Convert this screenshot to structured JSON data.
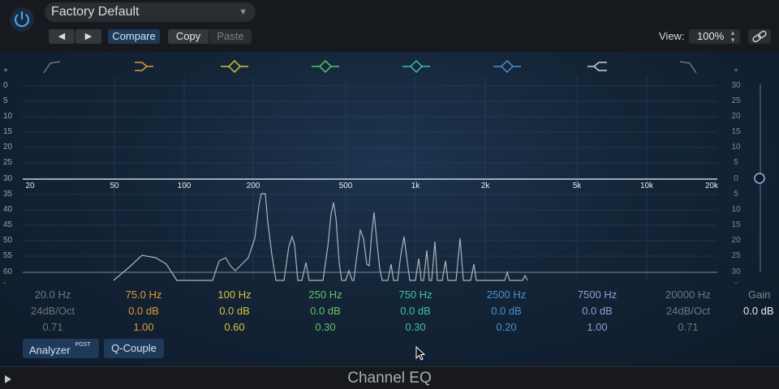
{
  "header": {
    "preset": "Factory Default",
    "compare_label": "Compare",
    "copy_label": "Copy",
    "paste_label": "Paste",
    "view_label": "View:",
    "view_value": "100%"
  },
  "eq": {
    "db_scale_left": [
      "+",
      "0",
      "5",
      "10",
      "15",
      "20",
      "25",
      "30",
      "35",
      "40",
      "45",
      "50",
      "55",
      "60",
      "-"
    ],
    "db_scale_right": [
      "+",
      "30",
      "25",
      "20",
      "15",
      "10",
      "5",
      "0",
      "5",
      "10",
      "15",
      "20",
      "25",
      "30",
      "-"
    ],
    "freq_ticks": [
      "20",
      "50",
      "100",
      "200",
      "500",
      "1k",
      "2k",
      "5k",
      "10k",
      "20k"
    ],
    "bands": [
      {
        "freq": "20.0 Hz",
        "gain": "24dB/Oct",
        "q": "0.71",
        "color": "#6b7680",
        "shape": "low-cut-icon"
      },
      {
        "freq": "75.0 Hz",
        "gain": "0.0 dB",
        "q": "1.00",
        "color": "#e09a3a",
        "shape": "low-shelf-icon"
      },
      {
        "freq": "100 Hz",
        "gain": "0.0 dB",
        "q": "0.60",
        "color": "#d4c23a",
        "shape": "bell-icon"
      },
      {
        "freq": "250 Hz",
        "gain": "0.0 dB",
        "q": "0.30",
        "color": "#5ec46a",
        "shape": "bell-icon"
      },
      {
        "freq": "750 Hz",
        "gain": "0.0 dB",
        "q": "0.30",
        "color": "#3fc2a4",
        "shape": "bell-icon"
      },
      {
        "freq": "2500 Hz",
        "gain": "0.0 dB",
        "q": "0.20",
        "color": "#4a90d0",
        "shape": "bell-icon"
      },
      {
        "freq": "7500 Hz",
        "gain": "0.0 dB",
        "q": "1.00",
        "color": "#9a96d8",
        "shape": "high-shelf-icon"
      },
      {
        "freq": "20000 Hz",
        "gain": "24dB/Oct",
        "q": "0.71",
        "color": "#6b7680",
        "shape": "high-cut-icon"
      }
    ],
    "gain_label": "Gain",
    "gain_value": "0.0 dB"
  },
  "buttons": {
    "analyzer": "Analyzer",
    "analyzer_badge": "POST",
    "qcouple": "Q-Couple"
  },
  "footer": {
    "title": "Channel EQ"
  }
}
